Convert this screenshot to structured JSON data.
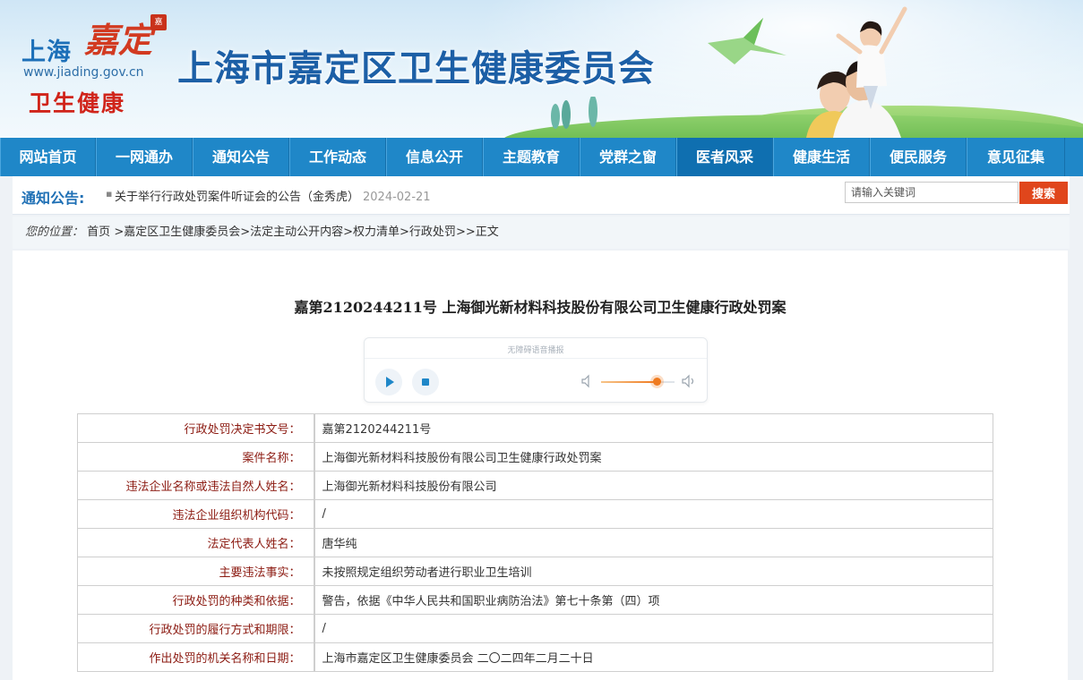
{
  "header": {
    "logo_city": "上海",
    "logo_calligraphy": "嘉定",
    "logo_seal": "嘉",
    "logo_url": "www.jiading.gov.cn",
    "logo_sub": "卫生健康",
    "site_title": "上海市嘉定区卫生健康委员会"
  },
  "nav": {
    "items": [
      {
        "label": "网站首页"
      },
      {
        "label": "一网通办"
      },
      {
        "label": "通知公告"
      },
      {
        "label": "工作动态"
      },
      {
        "label": "信息公开"
      },
      {
        "label": "主题教育"
      },
      {
        "label": "党群之窗"
      },
      {
        "label": "医者风采"
      },
      {
        "label": "健康生活"
      },
      {
        "label": "便民服务"
      },
      {
        "label": "意见征集"
      }
    ],
    "active_index": 7,
    "colors": {
      "bar": "#1f87c8",
      "active": "#0f6fb0"
    }
  },
  "notice": {
    "label": "通知公告:",
    "bullet": "▪",
    "text": "关于举行行政处罚案件听证会的公告（金秀虎）",
    "date": "2024-02-21"
  },
  "search": {
    "placeholder": "请输入关键词",
    "button_label": "搜索"
  },
  "breadcrumb": {
    "label": "您的位置：",
    "items": [
      "首页",
      ">嘉定区卫生健康委员会",
      ">法定主动公开内容",
      ">权力清单",
      ">行政处罚",
      ">",
      ">正文"
    ]
  },
  "article": {
    "title": "嘉第2120244211号  上海御光新材料科技股份有限公司卫生健康行政处罚案"
  },
  "player": {
    "title": "无障碍语音播报",
    "volume": 0.76,
    "icons": [
      "play-icon",
      "stop-icon",
      "volume-low-icon",
      "volume-high-icon"
    ]
  },
  "table": {
    "rows": [
      {
        "key": "行政处罚决定书文号：",
        "value": "嘉第2120244211号"
      },
      {
        "key": "案件名称：",
        "value": "上海御光新材料科技股份有限公司卫生健康行政处罚案"
      },
      {
        "key": "违法企业名称或违法自然人姓名：",
        "value": "上海御光新材料科技股份有限公司"
      },
      {
        "key": "违法企业组织机构代码：",
        "value": "/"
      },
      {
        "key": "法定代表人姓名：",
        "value": "唐华纯"
      },
      {
        "key": "主要违法事实：",
        "value": "未按照规定组织劳动者进行职业卫生培训"
      },
      {
        "key": "行政处罚的种类和依据：",
        "value": "警告，依据《中华人民共和国职业病防治法》第七十条第（四）项"
      },
      {
        "key": "行政处罚的履行方式和期限：",
        "value": "/"
      },
      {
        "key": "作出处罚的机关名称和日期：",
        "value": "上海市嘉定区卫生健康委员会  二〇二四年二月二十日"
      }
    ],
    "key_color": "#8c1b12"
  }
}
